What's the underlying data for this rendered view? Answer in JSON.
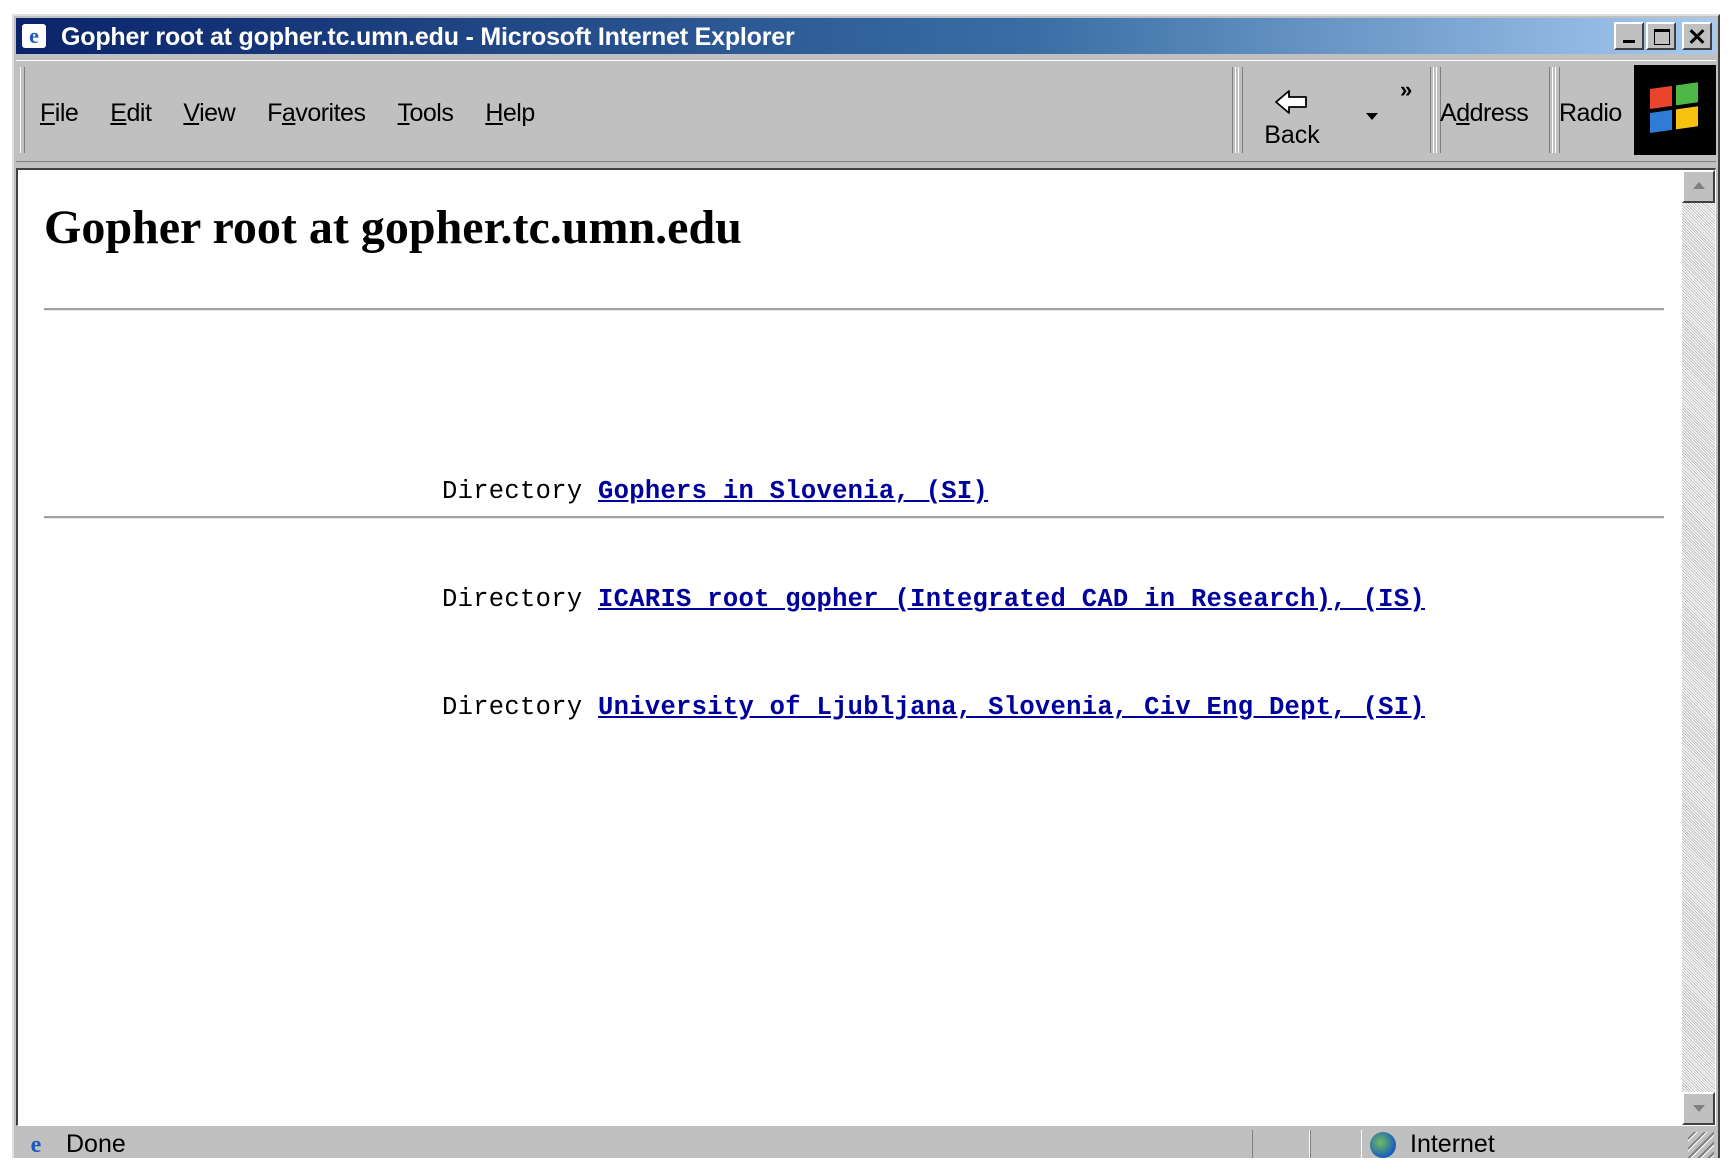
{
  "window": {
    "title": "Gopher root at gopher.tc.umn.edu - Microsoft Internet Explorer"
  },
  "menu": {
    "items": [
      {
        "pre": "",
        "key": "F",
        "post": "ile"
      },
      {
        "pre": "",
        "key": "E",
        "post": "dit"
      },
      {
        "pre": "",
        "key": "V",
        "post": "iew"
      },
      {
        "pre": "F",
        "key": "a",
        "post": "vorites"
      },
      {
        "pre": "",
        "key": "T",
        "post": "ools"
      },
      {
        "pre": "",
        "key": "H",
        "post": "elp"
      }
    ]
  },
  "toolbar": {
    "back_label": "Back",
    "chevron": "»",
    "address_pre": "A",
    "address_key": "d",
    "address_post": "dress",
    "radio_label": "Radio"
  },
  "page": {
    "heading": "Gopher root at gopher.tc.umn.edu",
    "entries": [
      {
        "type": "Directory",
        "label": "Gophers in Slovenia, (SI)"
      },
      {
        "type": "Directory",
        "label": "ICARIS root gopher (Integrated CAD in Research), (IS)"
      },
      {
        "type": "Directory",
        "label": "University of Ljubljana, Slovenia, Civ Eng Dept, (SI)"
      }
    ]
  },
  "status": {
    "text": "Done",
    "zone": "Internet"
  },
  "colors": {
    "titlebar_start": "#0a246a",
    "titlebar_end": "#a6caf0",
    "link": "#00009c",
    "chrome": "#c0c0c0"
  },
  "icons": {
    "app": "ie-logo-icon",
    "back": "back-arrow-icon",
    "throbber": "windows-logo-icon",
    "zone": "globe-icon",
    "status": "ie-page-icon"
  }
}
